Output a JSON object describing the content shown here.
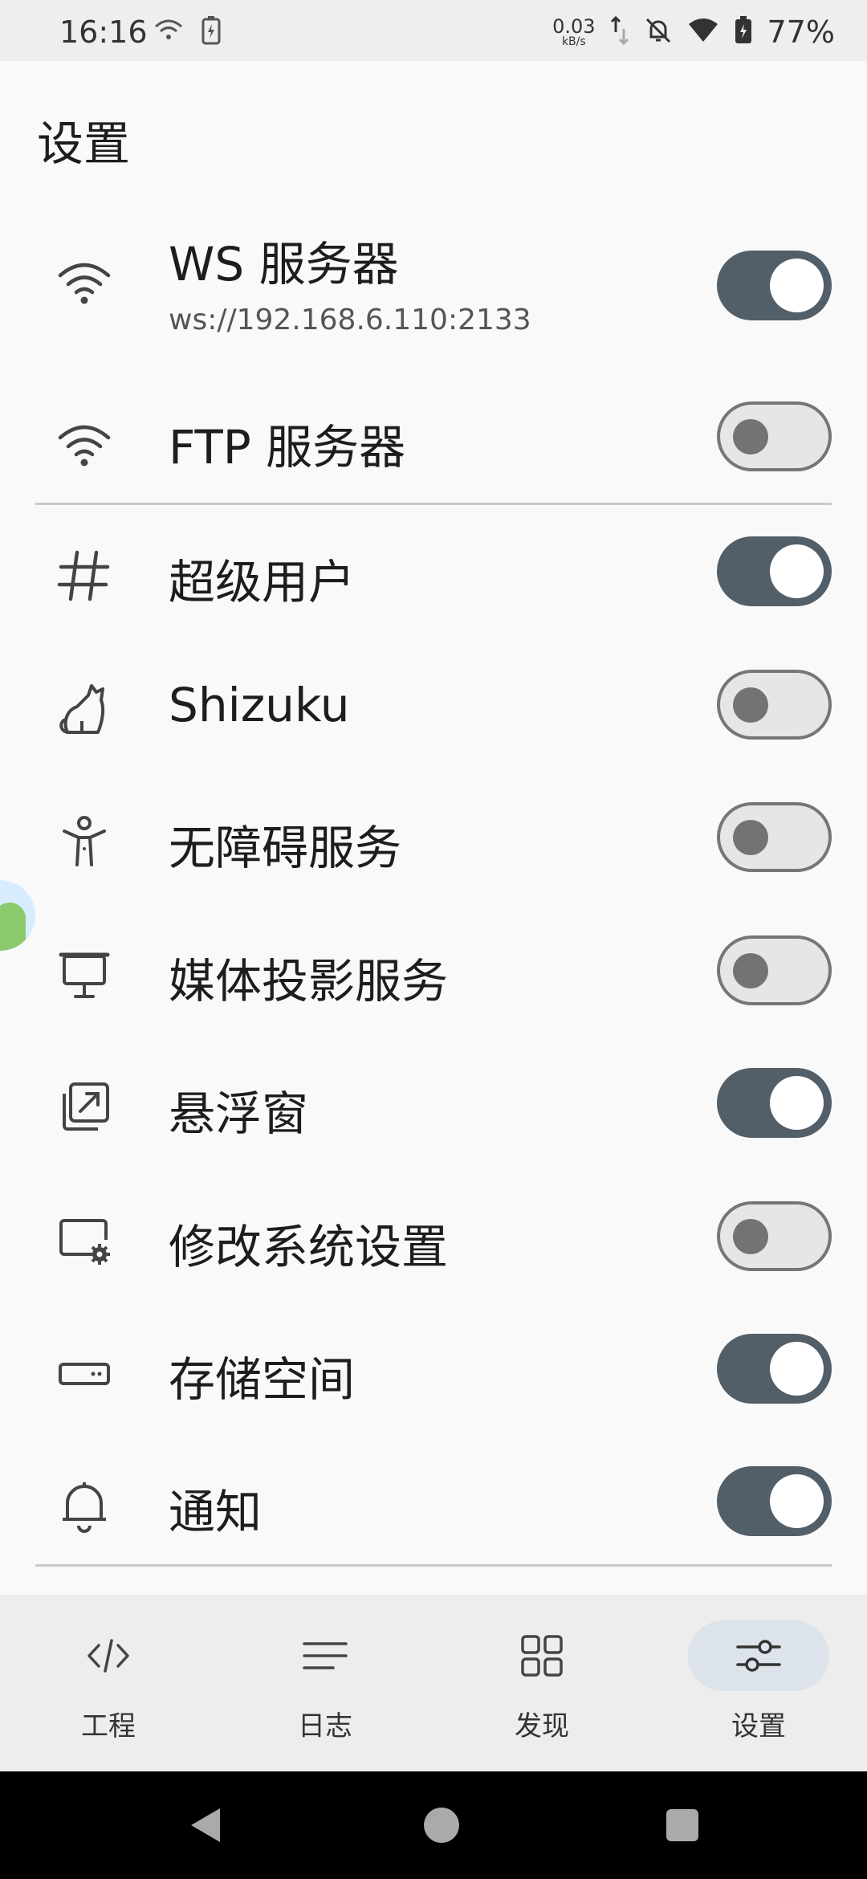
{
  "status_bar": {
    "time": "16:16",
    "net_speed_value": "0.03",
    "net_speed_unit": "kB/s",
    "battery_percent": "77%"
  },
  "page": {
    "title": "设置"
  },
  "settings": {
    "ws_server": {
      "label": "WS 服务器",
      "subtitle": "ws://192.168.6.110:2133",
      "enabled": true,
      "icon": "wifi-icon"
    },
    "ftp_server": {
      "label": "FTP 服务器",
      "enabled": false,
      "icon": "wifi-icon"
    },
    "superuser": {
      "label": "超级用户",
      "enabled": true,
      "icon": "hash-icon"
    },
    "shizuku": {
      "label": "Shizuku",
      "enabled": false,
      "icon": "cat-icon"
    },
    "accessibility": {
      "label": "无障碍服务",
      "enabled": false,
      "icon": "accessibility-icon"
    },
    "media_projection": {
      "label": "媒体投影服务",
      "enabled": false,
      "icon": "projector-icon"
    },
    "floating_window": {
      "label": "悬浮窗",
      "enabled": true,
      "icon": "floating-window-icon"
    },
    "modify_settings": {
      "label": "修改系统设置",
      "enabled": false,
      "icon": "screen-gear-icon"
    },
    "storage": {
      "label": "存储空间",
      "enabled": true,
      "icon": "storage-icon"
    },
    "notifications": {
      "label": "通知",
      "enabled": true,
      "icon": "bell-icon"
    }
  },
  "bottom_nav": {
    "items": [
      {
        "label": "工程",
        "icon": "code-icon",
        "active": false
      },
      {
        "label": "日志",
        "icon": "list-icon",
        "active": false
      },
      {
        "label": "发现",
        "icon": "grid-icon",
        "active": false
      },
      {
        "label": "设置",
        "icon": "sliders-icon",
        "active": true
      }
    ]
  },
  "colors": {
    "toggle_on": "#525e68",
    "toggle_off_track": "#e6e6e6",
    "active_nav_pill": "#dde3ea",
    "background": "#f9f9f9"
  }
}
